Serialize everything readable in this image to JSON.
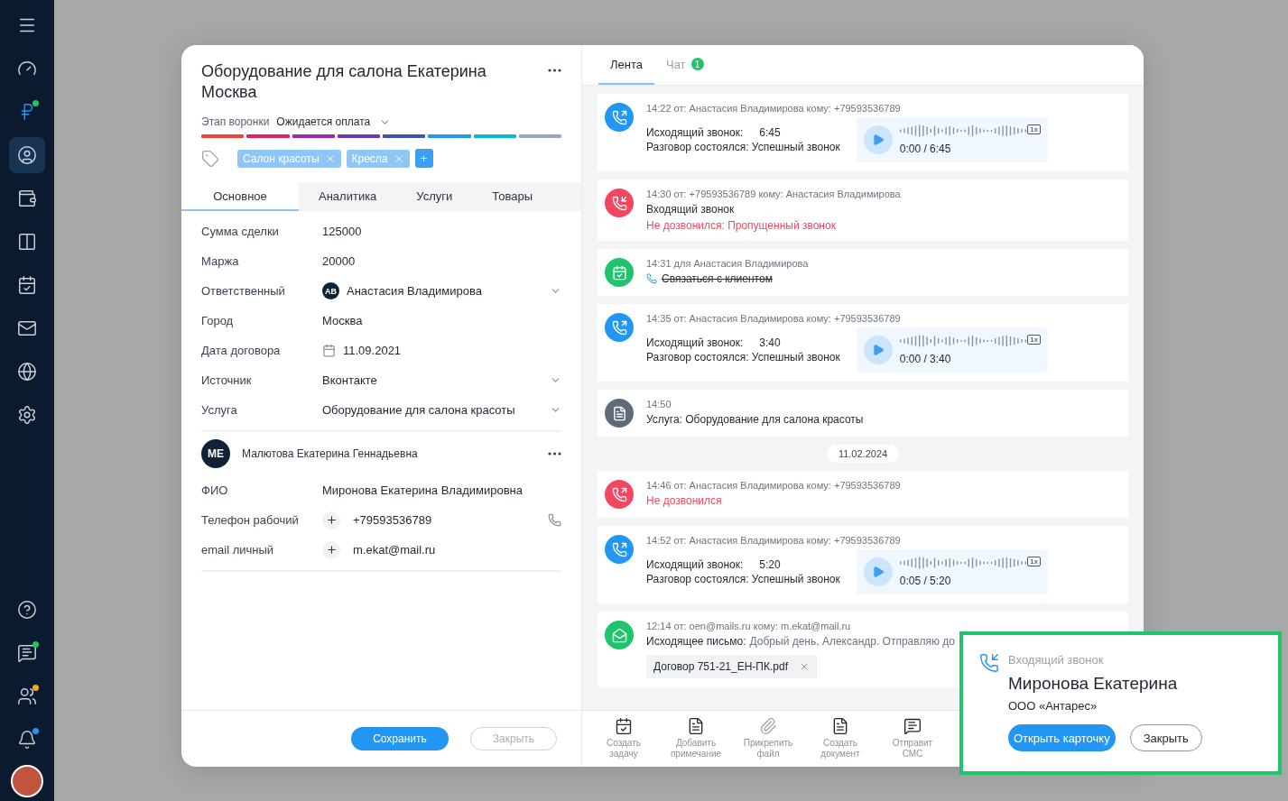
{
  "sidebar": {
    "top": [
      {
        "selected": false
      },
      {
        "selected": false
      },
      {
        "selected": false,
        "highlighted": true,
        "color": "#22c55e"
      },
      {
        "selected": true
      },
      {
        "selected": false
      },
      {
        "selected": false
      },
      {
        "selected": false
      },
      {
        "selected": false
      },
      {
        "selected": false
      },
      {
        "selected": false
      }
    ],
    "bottom": [
      {
        "selected": false
      },
      {
        "selected": false,
        "color": "#22c55e"
      },
      {
        "selected": false,
        "color": "#f5a623"
      },
      {
        "selected": false,
        "color": "#2196f3"
      }
    ]
  },
  "deal": {
    "title": "Оборудование для салона Екатерина Москва",
    "stage_label": "Этап воронки",
    "stage_value": "Ожидается оплата",
    "stages": [
      {
        "color": "#f44336"
      },
      {
        "color": "#e91e63"
      },
      {
        "color": "#9c27b0"
      },
      {
        "color": "#673ab7"
      },
      {
        "color": "#3f51b5"
      },
      {
        "color": "#2196f3"
      },
      {
        "color": "#00bcd4"
      },
      {
        "color": "#9aa6b2"
      }
    ],
    "tags": [
      {
        "label": "Салон красоты"
      },
      {
        "label": "Кресла"
      }
    ],
    "add_tag": "+",
    "tabs": [
      {
        "label": "Основное",
        "selected": true
      },
      {
        "label": "Аналитика",
        "selected": false
      },
      {
        "label": "Услуги",
        "selected": false
      },
      {
        "label": "Товары",
        "selected": false
      }
    ],
    "fields": [
      {
        "kind": "text",
        "label": "Сумма сделки",
        "value": "125000"
      },
      {
        "kind": "text",
        "label": "Маржа",
        "value": "20000"
      },
      {
        "kind": "person",
        "label": "Ответственный",
        "initials": "АВ",
        "value": "Анастасия Владимирова"
      },
      {
        "kind": "text",
        "label": "Город",
        "value": "Москва"
      },
      {
        "kind": "date",
        "label": "Дата договора",
        "value": "11.09.2021"
      },
      {
        "kind": "select",
        "label": "Источник",
        "value": "Вконтакте"
      },
      {
        "kind": "select",
        "label": "Услуга",
        "value": "Оборудование для салона красоты"
      }
    ],
    "contact": {
      "initials": "МЕ",
      "name": "Малютова Екатерина Геннадьевна",
      "fields": [
        {
          "kind": "text",
          "label": "ФИО",
          "value": "Миронова Екатерина Владимировна"
        },
        {
          "kind": "phone",
          "label": "Телефон рабочий",
          "value": "+79593536789"
        },
        {
          "kind": "email",
          "label": "email личный",
          "value": "m.ekat@mail.ru"
        }
      ]
    },
    "buttons": [
      {
        "label": "Сохранить",
        "disabled": false
      },
      {
        "label": "Закрыть",
        "disabled": true
      }
    ]
  },
  "feed": {
    "tabs": [
      {
        "label": "Лента",
        "selected": true
      },
      {
        "label": "Чат",
        "selected": false,
        "badge": "1"
      }
    ],
    "items": [
      {
        "kind": "outgoing_call",
        "color": "#2196f3",
        "meta": "14:22 от: Анастасия Владимирова кому: +79593536789",
        "title": "Исходящий звонок:",
        "duration": "6:45",
        "status": "Разговор состоялся: Успешный звонок",
        "error": false,
        "player": {
          "time": "0:00 / 6:45",
          "speed": "1x"
        }
      },
      {
        "kind": "incoming_call",
        "color": "#f2475e",
        "meta": "14:30 от: +79593536789 кому: Анастасия Владимирова",
        "title": "Входящий звонок",
        "status": "Не дозвонился: Пропущенный звонок",
        "error": true
      },
      {
        "kind": "task",
        "color": "#1fc46b",
        "meta": "14:31 для Анастасия Владимирова",
        "text": "Связаться с клиентом",
        "done": true
      },
      {
        "kind": "outgoing_call",
        "color": "#2196f3",
        "meta": "14:35 от: Анастасия Владимирова кому: +79593536789",
        "title": "Исходящий звонок:",
        "duration": "3:40",
        "status": "Разговор состоялся: Успешный звонок",
        "error": false,
        "player": {
          "time": "0:00 / 3:40",
          "speed": "1x"
        }
      },
      {
        "kind": "note",
        "color": "#5f6b78",
        "meta": "14:50",
        "text": "Услуга: Оборудование для салона красоты"
      },
      {
        "kind": "date",
        "text": "11.02.2024"
      },
      {
        "kind": "outgoing_call",
        "color": "#f2475e",
        "meta": "14:46 от: Анастасия Владимирова кому: +79593536789",
        "status": "Не дозвонился",
        "error": true
      },
      {
        "kind": "outgoing_call",
        "color": "#2196f3",
        "meta": "14:52 от: Анастасия Владимирова кому: +79593536789",
        "title": "Исходящий звонок:",
        "duration": "5:20",
        "status": "Разговор состоялся: Успешный звонок",
        "error": false,
        "player": {
          "time": "0:05 / 5:20",
          "speed": "1x"
        }
      },
      {
        "kind": "email",
        "color": "#1fc46b",
        "meta": "12:14 от: oen@mails.ru кому: m.ekat@mail.ru",
        "label": "Исходящее письмо:",
        "text": "Добрый день, Александр. Отправляю до",
        "attachment": "Договор 751-21_ЕН-ПК.pdf"
      }
    ],
    "actions": [
      {
        "label": "Создать задачу"
      },
      {
        "label": "Добавить примечание"
      },
      {
        "label": "Прикрепить файл"
      },
      {
        "label": "Создать документ"
      },
      {
        "label": "Отправит СМС"
      }
    ]
  },
  "popup": {
    "title": "Входящий звонок",
    "name": "Миронова Екатерина",
    "company": "ООО «Антарес»",
    "buttons": [
      {
        "label": "Открыть карточку",
        "primary": true
      },
      {
        "label": "Закрыть",
        "primary": false
      }
    ]
  }
}
